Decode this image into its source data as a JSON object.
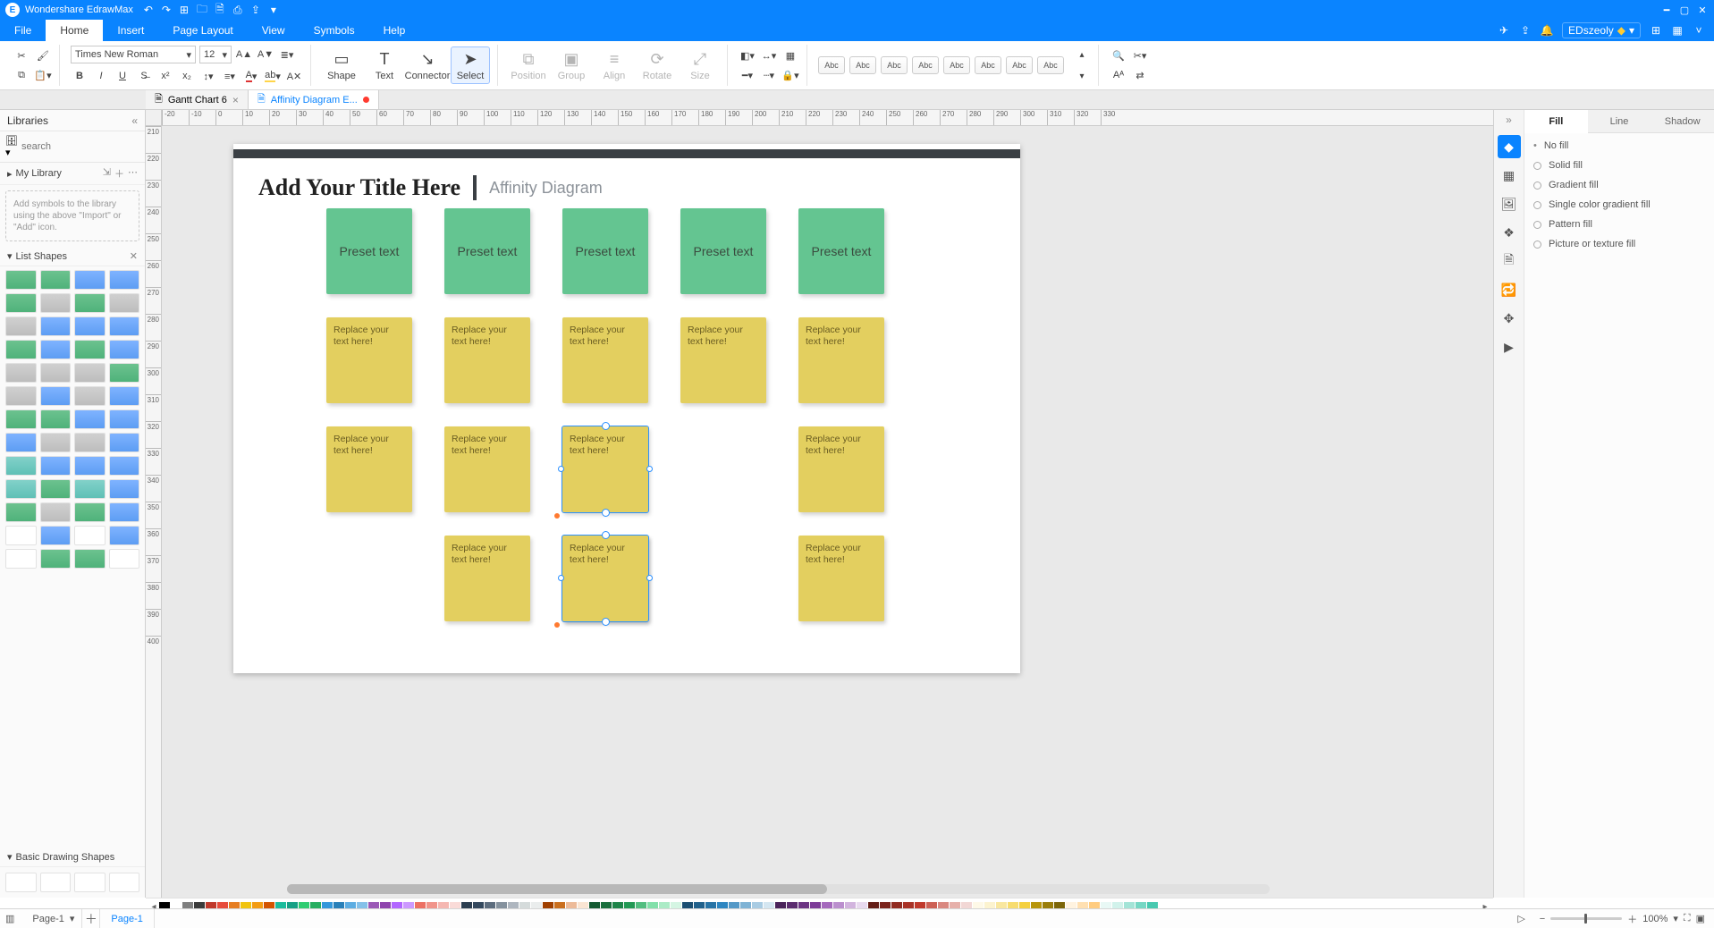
{
  "app": {
    "title": "Wondershare EdrawMax"
  },
  "qat": [
    "undo",
    "redo",
    "new",
    "open",
    "save",
    "print",
    "export",
    "more"
  ],
  "window_buttons": [
    "min",
    "max",
    "close"
  ],
  "menu": {
    "items": [
      "File",
      "Home",
      "Insert",
      "Page Layout",
      "View",
      "Symbols",
      "Help"
    ],
    "active": 1,
    "user": "EDszeoly",
    "right_icons": [
      "send-icon",
      "share-icon",
      "bell-icon"
    ]
  },
  "ribbon": {
    "font": {
      "family": "Times New Roman",
      "size": "12"
    },
    "tools": [
      {
        "id": "shape",
        "label": "Shape",
        "glyph": "▭"
      },
      {
        "id": "text",
        "label": "Text",
        "glyph": "T"
      },
      {
        "id": "connector",
        "label": "Connector",
        "glyph": "↘"
      },
      {
        "id": "select",
        "label": "Select",
        "glyph": "➤",
        "active": true
      }
    ],
    "arrange": [
      {
        "id": "position",
        "label": "Position",
        "glyph": "⧉"
      },
      {
        "id": "group",
        "label": "Group",
        "glyph": "▣"
      },
      {
        "id": "align",
        "label": "Align",
        "glyph": "≡"
      },
      {
        "id": "rotate",
        "label": "Rotate",
        "glyph": "⟳"
      },
      {
        "id": "size",
        "label": "Size",
        "glyph": "⤢"
      }
    ],
    "styles": [
      "Abc",
      "Abc",
      "Abc",
      "Abc",
      "Abc",
      "Abc",
      "Abc",
      "Abc"
    ]
  },
  "doctabs": [
    {
      "label": "Gantt Chart 6",
      "active": false,
      "modified": false
    },
    {
      "label": "Affinity Diagram E...",
      "active": true,
      "modified": true
    }
  ],
  "ruler_h": [
    "-20",
    "-10",
    "0",
    "10",
    "20",
    "30",
    "40",
    "50",
    "60",
    "70",
    "80",
    "90",
    "100",
    "110",
    "120",
    "130",
    "140",
    "150",
    "160",
    "170",
    "180",
    "190",
    "200",
    "210",
    "220",
    "230",
    "240",
    "250",
    "260",
    "270",
    "280",
    "290",
    "300",
    "310",
    "320",
    "330"
  ],
  "ruler_v": [
    "210",
    "220",
    "230",
    "240",
    "250",
    "260",
    "270",
    "280",
    "290",
    "300",
    "310",
    "320",
    "330",
    "340",
    "350",
    "360",
    "370",
    "380",
    "390",
    "400"
  ],
  "libraries": {
    "header": "Libraries",
    "search_placeholder": "search",
    "my_library": "My Library",
    "placeholder_text": "Add symbols to the library using the above \"Import\" or \"Add\" icon.",
    "sections": [
      "List Shapes",
      "Basic Drawing Shapes"
    ]
  },
  "page_content": {
    "title": "Add Your Title Here",
    "subtitle": "Affinity Diagram",
    "preset": "Preset text",
    "replace": "Replace your text here!",
    "columns_x": [
      0,
      132,
      264,
      396,
      528
    ],
    "green_y": 0,
    "yellow_rows_y": [
      122,
      244,
      366
    ],
    "layout": [
      [
        1,
        1,
        1,
        1,
        1
      ],
      [
        1,
        1,
        1,
        0,
        1
      ],
      [
        0,
        1,
        1,
        0,
        1
      ]
    ],
    "selected": {
      "row": 1,
      "col": 2
    }
  },
  "right_panel": {
    "tabs": [
      "Fill",
      "Line",
      "Shadow"
    ],
    "active": 0,
    "options": [
      "No fill",
      "Solid fill",
      "Gradient fill",
      "Single color gradient fill",
      "Pattern fill",
      "Picture or texture fill"
    ],
    "strip_icons": [
      "paint-icon",
      "grid-icon",
      "image-icon",
      "layers-icon",
      "page-icon",
      "repeat-icon",
      "focus-icon",
      "present-icon"
    ]
  },
  "color_swatches": [
    "#000000",
    "#ffffff",
    "#7f7f7f",
    "#3b3b3b",
    "#c0392b",
    "#e74c3c",
    "#e67e22",
    "#f1c40f",
    "#f39c12",
    "#d35400",
    "#1abc9c",
    "#16a085",
    "#2ecc71",
    "#27ae60",
    "#3498db",
    "#2980b9",
    "#5dade2",
    "#85c1e9",
    "#9b59b6",
    "#8e44ad",
    "#b266ff",
    "#cc99ff",
    "#ec7063",
    "#f1948a",
    "#f5b7b1",
    "#fadbd8",
    "#2c3e50",
    "#34495e",
    "#5d6d7e",
    "#85929e",
    "#aeb6bf",
    "#d5dbdb",
    "#eaeded",
    "#a04000",
    "#ca6f1e",
    "#edbb99",
    "#fae5d3",
    "#145a32",
    "#196f3d",
    "#1e8449",
    "#229954",
    "#52be80",
    "#82e0aa",
    "#abebc6",
    "#d5f5e3",
    "#1b4f72",
    "#21618c",
    "#2874a6",
    "#2e86c1",
    "#5499c7",
    "#7fb3d5",
    "#a9cce3",
    "#d4e6f1",
    "#4a235a",
    "#5b2c6f",
    "#6c3483",
    "#7d3c98",
    "#a569bd",
    "#bb8fce",
    "#d2b4de",
    "#e8daef",
    "#641e16",
    "#7b241c",
    "#922b21",
    "#a93226",
    "#c0392b",
    "#cd6155",
    "#d98880",
    "#e6b0aa",
    "#f2d7d5",
    "#fef9e7",
    "#fcf3cf",
    "#f9e79f",
    "#f7dc6f",
    "#f4d03f",
    "#b7950b",
    "#9a7d0a",
    "#7d6608",
    "#fff3e0",
    "#ffe0b2",
    "#ffcc80",
    "#e8f8f5",
    "#d1f2eb",
    "#a3e4d7",
    "#76d7c4",
    "#48c9b0"
  ],
  "status": {
    "page_label": "Page-1",
    "page_tab": "Page-1",
    "zoom": "100%"
  }
}
